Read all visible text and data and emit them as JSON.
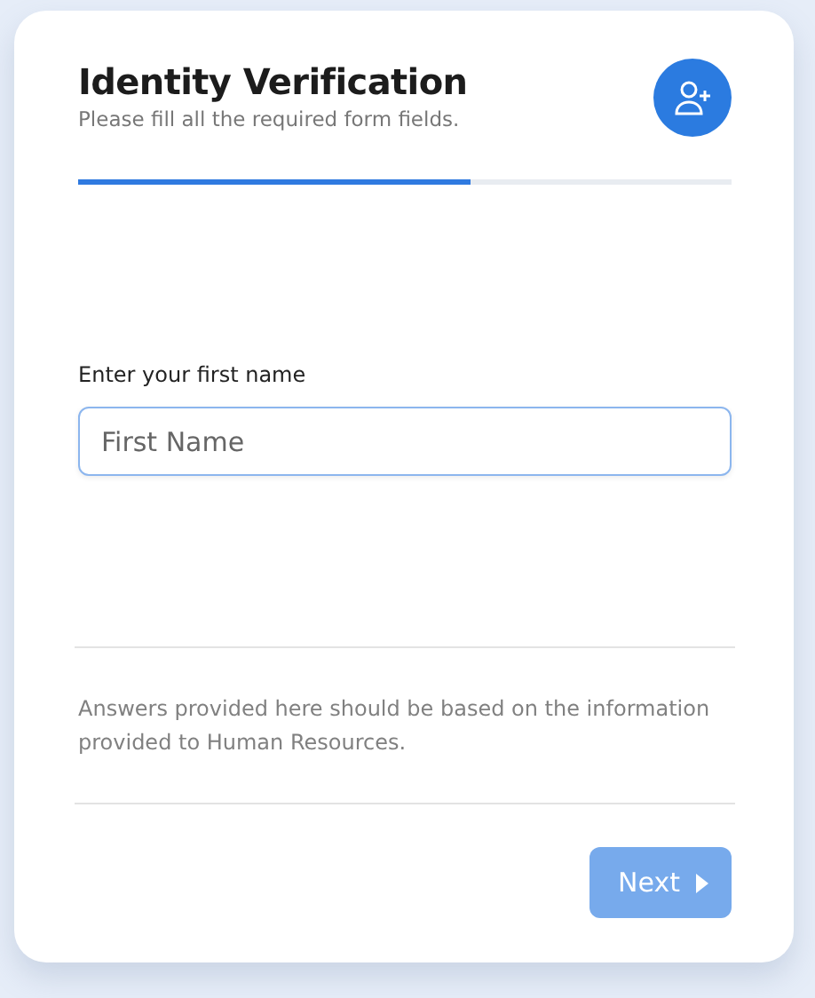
{
  "form": {
    "title": "Identity Verification",
    "subtitle": "Please fill all the required form fields.",
    "progress": {
      "level": 0.6
    },
    "field": {
      "label": "Enter your first name",
      "placeholder": "First Name"
    },
    "note": "Answers provided here should be based on the information provided to Human Resources.",
    "next_button": {
      "label": "Next",
      "disabled": true
    }
  }
}
